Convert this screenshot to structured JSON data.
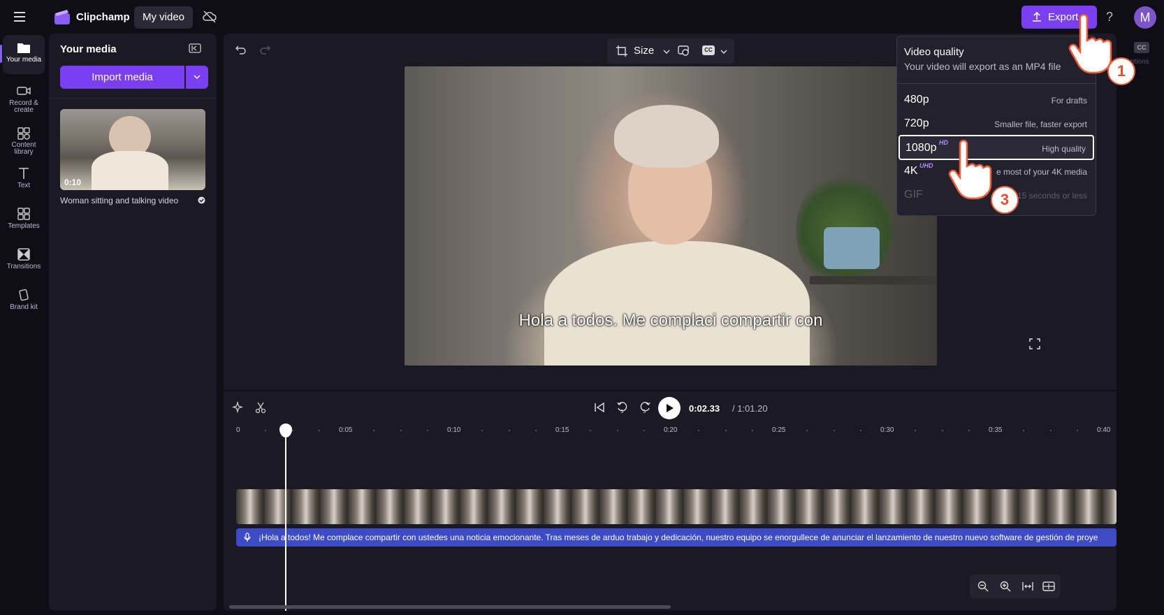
{
  "app": {
    "name": "Clipchamp",
    "project_title": "My video",
    "export_label": "Export",
    "help": "?",
    "avatar_initial": "M"
  },
  "rail": [
    {
      "label": "Your media"
    },
    {
      "label": "Record &\ncreate"
    },
    {
      "label": "Content\nlibrary"
    },
    {
      "label": "Text"
    },
    {
      "label": "Templates"
    },
    {
      "label": "Transitions"
    },
    {
      "label": "Brand kit"
    }
  ],
  "media": {
    "title": "Your media",
    "import_label": "Import media",
    "items": [
      {
        "name": "Woman sitting and talking video",
        "duration": "0:10"
      }
    ]
  },
  "preview": {
    "size_label": "Size",
    "cc_label": "CC",
    "caption": "Hola a todos. Me complaci compartir con"
  },
  "export_dropdown": {
    "title": "Video quality",
    "subtitle": "Your video will export as an MP4 file",
    "options": [
      {
        "res": "480p",
        "badge": "",
        "desc": "For drafts",
        "state": "normal"
      },
      {
        "res": "720p",
        "badge": "",
        "desc": "Smaller file, faster export",
        "state": "normal"
      },
      {
        "res": "1080p",
        "badge": "HD",
        "desc": "High quality",
        "state": "selected"
      },
      {
        "res": "4K",
        "badge": "UHD",
        "desc": "e most of your 4K media",
        "state": "normal"
      },
      {
        "res": "GIF",
        "badge": "",
        "desc": "15 seconds or less",
        "state": "disabled"
      }
    ]
  },
  "right_rail": {
    "cc": "CC",
    "label": "ptions"
  },
  "playback": {
    "current": "0:02.33",
    "total": "/ 1:01.20"
  },
  "ruler": [
    "0",
    "0:05",
    "0:10",
    "0:15",
    "0:20",
    "0:25",
    "0:30",
    "0:35",
    "0:40"
  ],
  "caption_track": "¡Hola a todos! Me complace compartir con ustedes una noticia emocionante. Tras meses de arduo trabajo y dedicación, nuestro equipo se enorgullece de anunciar el lanzamiento de nuestro nuevo software de gestión de proye",
  "steps": [
    "1",
    "3"
  ],
  "colors": {
    "accent": "#7b3ff2",
    "caption_track": "#3d4bc7",
    "panel": "#1b1a24",
    "background": "#0f0e16"
  }
}
